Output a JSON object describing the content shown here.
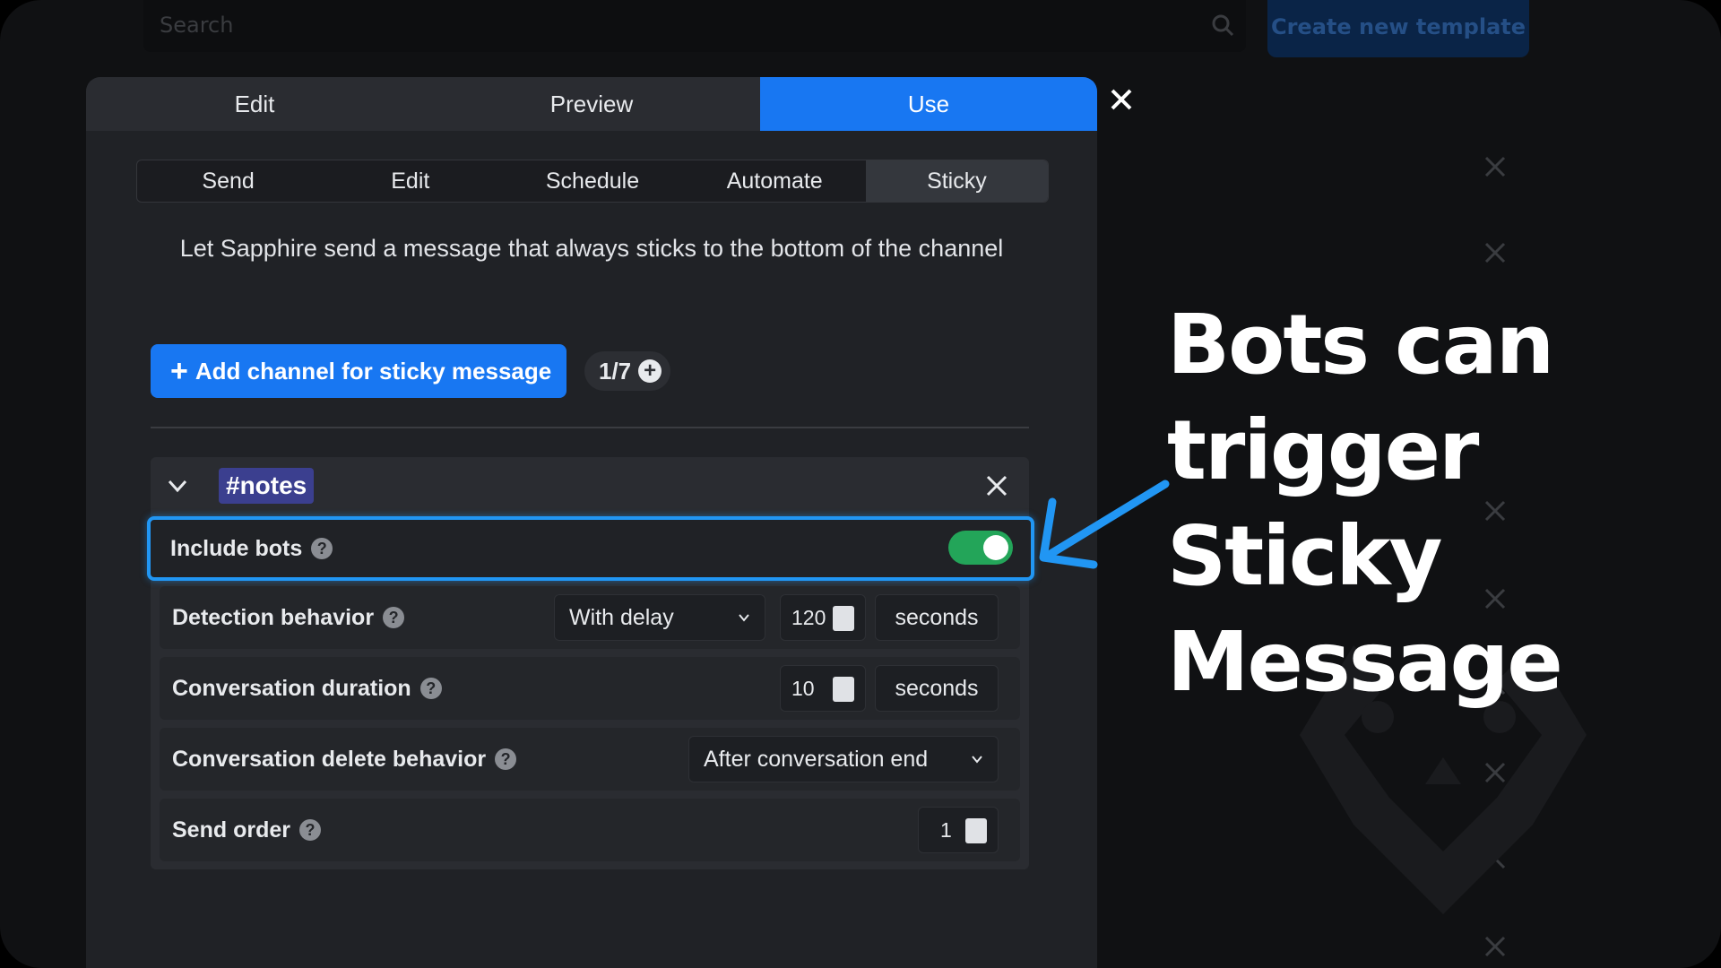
{
  "background": {
    "search_placeholder": "Search",
    "create_button": "Create new template"
  },
  "modal": {
    "top_tabs": [
      "Edit",
      "Preview",
      "Use"
    ],
    "active_top_tab": "Use",
    "sub_tabs": [
      "Send",
      "Edit",
      "Schedule",
      "Automate",
      "Sticky"
    ],
    "active_sub_tab": "Sticky",
    "description": "Let Sapphire send a message that always sticks to the bottom of the channel",
    "add_button": "Add channel for sticky message",
    "counter": "1/7",
    "channel": {
      "hash": "#",
      "name": "notes",
      "include_bots": {
        "label": "Include bots",
        "enabled": true
      },
      "detection": {
        "label": "Detection behavior",
        "select_value": "With delay",
        "number": "120",
        "unit": "seconds"
      },
      "duration": {
        "label": "Conversation duration",
        "number": "10",
        "unit": "seconds"
      },
      "delete": {
        "label": "Conversation delete behavior",
        "select_value": "After conversation end"
      },
      "send_order": {
        "label": "Send order",
        "number": "1"
      }
    }
  },
  "annotation": {
    "lines": [
      "Bots can",
      "trigger Sticky",
      "Message"
    ],
    "arrow_color": "#2196f3"
  },
  "colors": {
    "accent": "#1877f2",
    "toggle_on": "#23a559",
    "channel_tag": "#3b3f8f"
  }
}
